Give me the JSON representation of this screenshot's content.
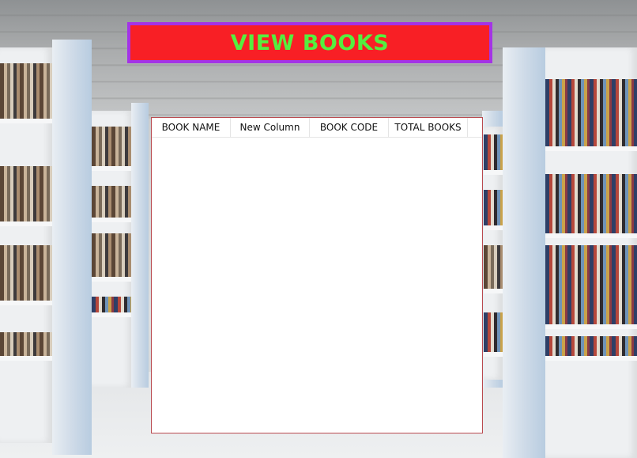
{
  "window": {
    "title": "VIEW BOOKS"
  },
  "colors": {
    "banner_background": "#f81f25",
    "banner_border": "#a433e6",
    "banner_text": "#55ef3f",
    "grid_border": "#b94a4f"
  },
  "grid": {
    "columns": [
      {
        "label": "BOOK NAME"
      },
      {
        "label": "New Column"
      },
      {
        "label": "BOOK CODE"
      },
      {
        "label": "TOTAL BOOKS"
      }
    ],
    "rows": []
  }
}
